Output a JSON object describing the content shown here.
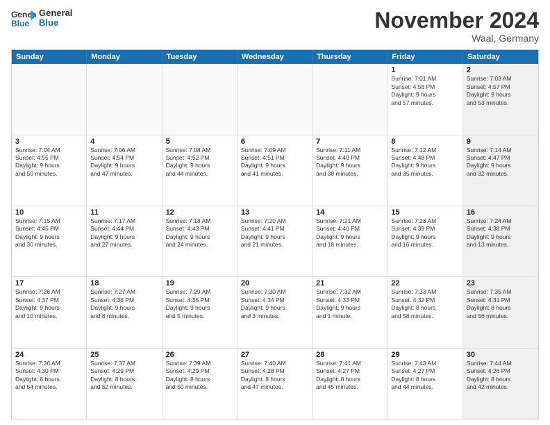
{
  "logo": {
    "line1": "General",
    "line2": "Blue"
  },
  "title": "November 2024",
  "subtitle": "Waal, Germany",
  "days": [
    "Sunday",
    "Monday",
    "Tuesday",
    "Wednesday",
    "Thursday",
    "Friday",
    "Saturday"
  ],
  "rows": [
    [
      {
        "day": "",
        "empty": true
      },
      {
        "day": "",
        "empty": true
      },
      {
        "day": "",
        "empty": true
      },
      {
        "day": "",
        "empty": true
      },
      {
        "day": "",
        "empty": true
      },
      {
        "day": "1",
        "text": "Sunrise: 7:01 AM\nSunset: 4:58 PM\nDaylight: 9 hours\nand 57 minutes."
      },
      {
        "day": "2",
        "text": "Sunrise: 7:03 AM\nSunset: 4:57 PM\nDaylight: 9 hours\nand 53 minutes.",
        "shaded": true
      }
    ],
    [
      {
        "day": "3",
        "text": "Sunrise: 7:04 AM\nSunset: 4:55 PM\nDaylight: 9 hours\nand 50 minutes."
      },
      {
        "day": "4",
        "text": "Sunrise: 7:06 AM\nSunset: 4:54 PM\nDaylight: 9 hours\nand 47 minutes."
      },
      {
        "day": "5",
        "text": "Sunrise: 7:08 AM\nSunset: 4:52 PM\nDaylight: 9 hours\nand 44 minutes."
      },
      {
        "day": "6",
        "text": "Sunrise: 7:09 AM\nSunset: 4:51 PM\nDaylight: 9 hours\nand 41 minutes."
      },
      {
        "day": "7",
        "text": "Sunrise: 7:11 AM\nSunset: 4:49 PM\nDaylight: 9 hours\nand 38 minutes."
      },
      {
        "day": "8",
        "text": "Sunrise: 7:12 AM\nSunset: 4:48 PM\nDaylight: 9 hours\nand 35 minutes."
      },
      {
        "day": "9",
        "text": "Sunrise: 7:14 AM\nSunset: 4:47 PM\nDaylight: 9 hours\nand 32 minutes.",
        "shaded": true
      }
    ],
    [
      {
        "day": "10",
        "text": "Sunrise: 7:15 AM\nSunset: 4:45 PM\nDaylight: 9 hours\nand 30 minutes."
      },
      {
        "day": "11",
        "text": "Sunrise: 7:17 AM\nSunset: 4:44 PM\nDaylight: 9 hours\nand 27 minutes."
      },
      {
        "day": "12",
        "text": "Sunrise: 7:18 AM\nSunset: 4:43 PM\nDaylight: 9 hours\nand 24 minutes."
      },
      {
        "day": "13",
        "text": "Sunrise: 7:20 AM\nSunset: 4:41 PM\nDaylight: 9 hours\nand 21 minutes."
      },
      {
        "day": "14",
        "text": "Sunrise: 7:21 AM\nSunset: 4:40 PM\nDaylight: 9 hours\nand 18 minutes."
      },
      {
        "day": "15",
        "text": "Sunrise: 7:23 AM\nSunset: 4:39 PM\nDaylight: 9 hours\nand 16 minutes."
      },
      {
        "day": "16",
        "text": "Sunrise: 7:24 AM\nSunset: 4:38 PM\nDaylight: 9 hours\nand 13 minutes.",
        "shaded": true
      }
    ],
    [
      {
        "day": "17",
        "text": "Sunrise: 7:26 AM\nSunset: 4:37 PM\nDaylight: 9 hours\nand 10 minutes."
      },
      {
        "day": "18",
        "text": "Sunrise: 7:27 AM\nSunset: 4:36 PM\nDaylight: 9 hours\nand 8 minutes."
      },
      {
        "day": "19",
        "text": "Sunrise: 7:29 AM\nSunset: 4:35 PM\nDaylight: 9 hours\nand 5 minutes."
      },
      {
        "day": "20",
        "text": "Sunrise: 7:30 AM\nSunset: 4:34 PM\nDaylight: 9 hours\nand 3 minutes."
      },
      {
        "day": "21",
        "text": "Sunrise: 7:32 AM\nSunset: 4:33 PM\nDaylight: 9 hours\nand 1 minute."
      },
      {
        "day": "22",
        "text": "Sunrise: 7:33 AM\nSunset: 4:32 PM\nDaylight: 8 hours\nand 58 minutes."
      },
      {
        "day": "23",
        "text": "Sunrise: 7:35 AM\nSunset: 4:31 PM\nDaylight: 8 hours\nand 56 minutes.",
        "shaded": true
      }
    ],
    [
      {
        "day": "24",
        "text": "Sunrise: 7:36 AM\nSunset: 4:30 PM\nDaylight: 8 hours\nand 54 minutes."
      },
      {
        "day": "25",
        "text": "Sunrise: 7:37 AM\nSunset: 4:29 PM\nDaylight: 8 hours\nand 52 minutes."
      },
      {
        "day": "26",
        "text": "Sunrise: 7:39 AM\nSunset: 4:29 PM\nDaylight: 8 hours\nand 50 minutes."
      },
      {
        "day": "27",
        "text": "Sunrise: 7:40 AM\nSunset: 4:28 PM\nDaylight: 8 hours\nand 47 minutes."
      },
      {
        "day": "28",
        "text": "Sunrise: 7:41 AM\nSunset: 4:27 PM\nDaylight: 8 hours\nand 45 minutes."
      },
      {
        "day": "29",
        "text": "Sunrise: 7:43 AM\nSunset: 4:27 PM\nDaylight: 8 hours\nand 44 minutes."
      },
      {
        "day": "30",
        "text": "Sunrise: 7:44 AM\nSunset: 4:26 PM\nDaylight: 8 hours\nand 42 minutes.",
        "shaded": true
      }
    ]
  ]
}
